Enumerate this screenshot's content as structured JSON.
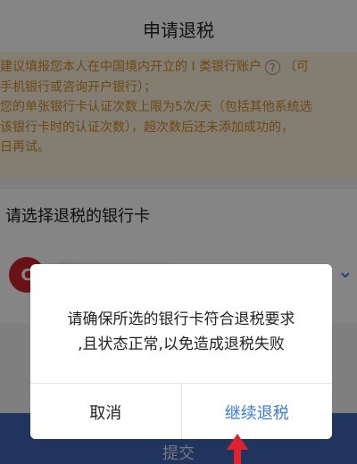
{
  "header": {
    "title": "申请退税"
  },
  "notice": {
    "lines": [
      "建议填报您本人在中国境内开立的 I 类银行账户",
      "手机银行或咨询开户银行）；",
      "您的单张银行卡认证次数上限为5次/天（包括其他系统选",
      "该银行卡时的认证次数），超次数后还未添加成功的，",
      "日再试。"
    ],
    "line1_tail": "（可",
    "help_icon": "question-circle-icon"
  },
  "section": {
    "label": "请选择退税的银行卡",
    "bank_logo_glyph": "C"
  },
  "submit": {
    "label": "提交"
  },
  "dialog": {
    "message_line1": "请确保所选的银行卡符合退税要求",
    "message_line2": ",且状态正常,以免造成退税失败",
    "cancel_label": "取消",
    "continue_label": "继续退税"
  },
  "colors": {
    "accent": "#3a7bd5",
    "notice_text": "#cf8a2a",
    "notice_bg": "#fbf1d9",
    "submit_bg": "#3f64b4",
    "arrow": "#e0212e"
  }
}
